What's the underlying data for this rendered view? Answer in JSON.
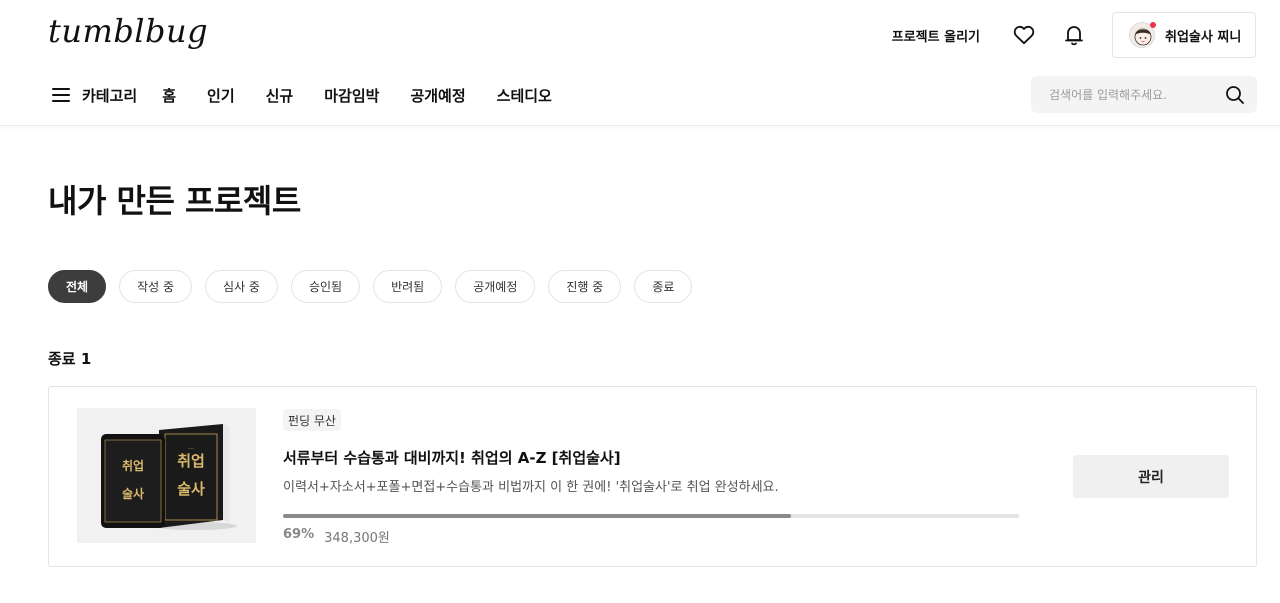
{
  "header": {
    "logo": "tumblbug",
    "upload_label": "프로젝트 올리기",
    "icons": {
      "like": "heart-icon",
      "alarm": "bell-icon",
      "search": "search-icon",
      "menu": "hamburger-icon"
    },
    "profile_name": "취업술사 찌니",
    "notification_color": "#f0314a"
  },
  "nav": {
    "category_label": "카테고리",
    "items": [
      {
        "label": "홈"
      },
      {
        "label": "인기"
      },
      {
        "label": "신규"
      },
      {
        "label": "마감임박"
      },
      {
        "label": "공개예정"
      },
      {
        "label": "스테디오"
      }
    ]
  },
  "search": {
    "placeholder": "검색어를 입력해주세요."
  },
  "page": {
    "title": "내가 만든 프로젝트"
  },
  "filters": [
    {
      "label": "전체",
      "active": true
    },
    {
      "label": "작성 중"
    },
    {
      "label": "심사 중"
    },
    {
      "label": "승인됨"
    },
    {
      "label": "반려됨"
    },
    {
      "label": "공개예정"
    },
    {
      "label": "진행 중"
    },
    {
      "label": "종료"
    }
  ],
  "section": {
    "title": "종료 1"
  },
  "project": {
    "badge": "펀딩 무산",
    "title": "서류부터 수습통과 대비까지! 취업의 A-Z [취업술사]",
    "description": "이력서+자소서+포폴+면접+수습통과 비법까지 이 한 권에! '취업술사'로 취업 완성하세요.",
    "progress": 69,
    "progress_label": "69%",
    "amount": "348,300원",
    "manage_label": "관리",
    "thumbnail_text": {
      "line1": "취업",
      "line2": "술사"
    }
  },
  "colors": {
    "active_chip": "#3d3d3d",
    "progress_fill": "#8a8a8a",
    "book_gold": "#c9a457"
  }
}
